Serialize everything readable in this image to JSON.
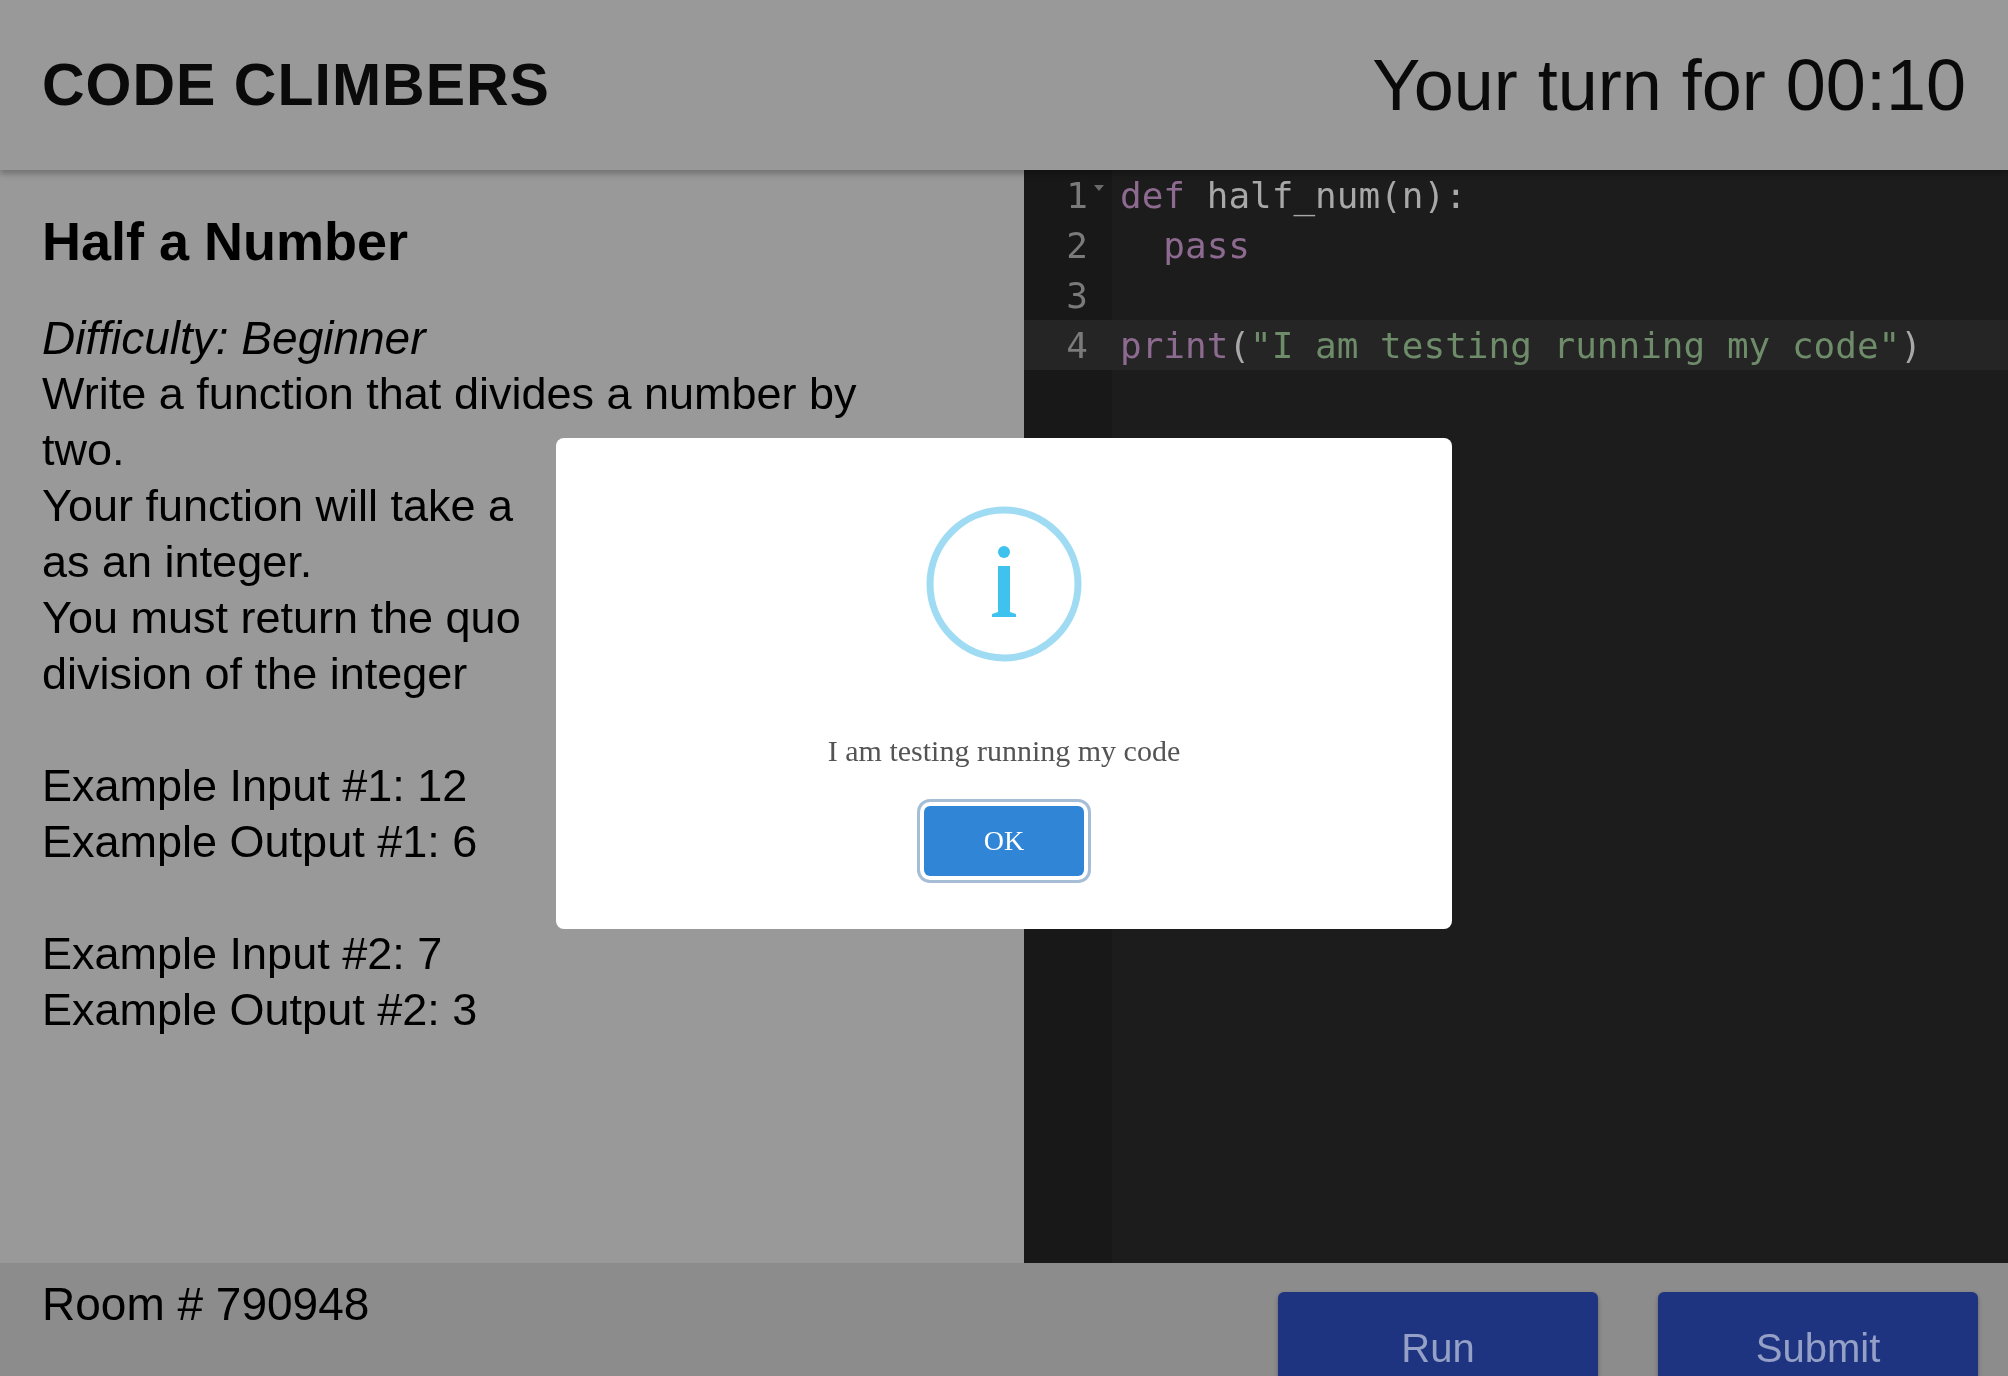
{
  "header": {
    "title": "CODE CLIMBERS",
    "timer": "Your turn for 00:10"
  },
  "problem": {
    "title": "Half a Number",
    "difficulty": "Difficulty: Beginner",
    "description": [
      "Write a function that divides a number by",
      "two.",
      "Your function will take a",
      "as an integer.",
      "You must return the quo",
      "division of the integer"
    ],
    "examples": [
      [
        "Example Input #1: 12",
        "Example Output #1: 6"
      ],
      [
        "Example Input #2: 7",
        "Example Output #2: 3"
      ]
    ]
  },
  "editor": {
    "lines": [
      {
        "number": "1",
        "foldable": true,
        "current": false,
        "tokens": [
          {
            "text": "def",
            "kind": "keyword"
          },
          {
            "text": " half_num(n):",
            "kind": "plain"
          }
        ]
      },
      {
        "number": "2",
        "foldable": false,
        "current": false,
        "tokens": [
          {
            "text": "  pass",
            "kind": "keyword"
          }
        ]
      },
      {
        "number": "3",
        "foldable": false,
        "current": false
      },
      {
        "number": "4",
        "foldable": false,
        "current": true,
        "tokens": [
          {
            "text": "print",
            "kind": "keyword"
          },
          {
            "text": "(",
            "kind": "plain"
          },
          {
            "text": "\"I am testing running my code\"",
            "kind": "string"
          },
          {
            "text": ")",
            "kind": "plain"
          }
        ]
      }
    ]
  },
  "footer": {
    "room": "Room # 790948",
    "buttons": [
      "Run",
      "Submit"
    ]
  },
  "dialog": {
    "message": "I am testing running my code",
    "button": "OK"
  }
}
